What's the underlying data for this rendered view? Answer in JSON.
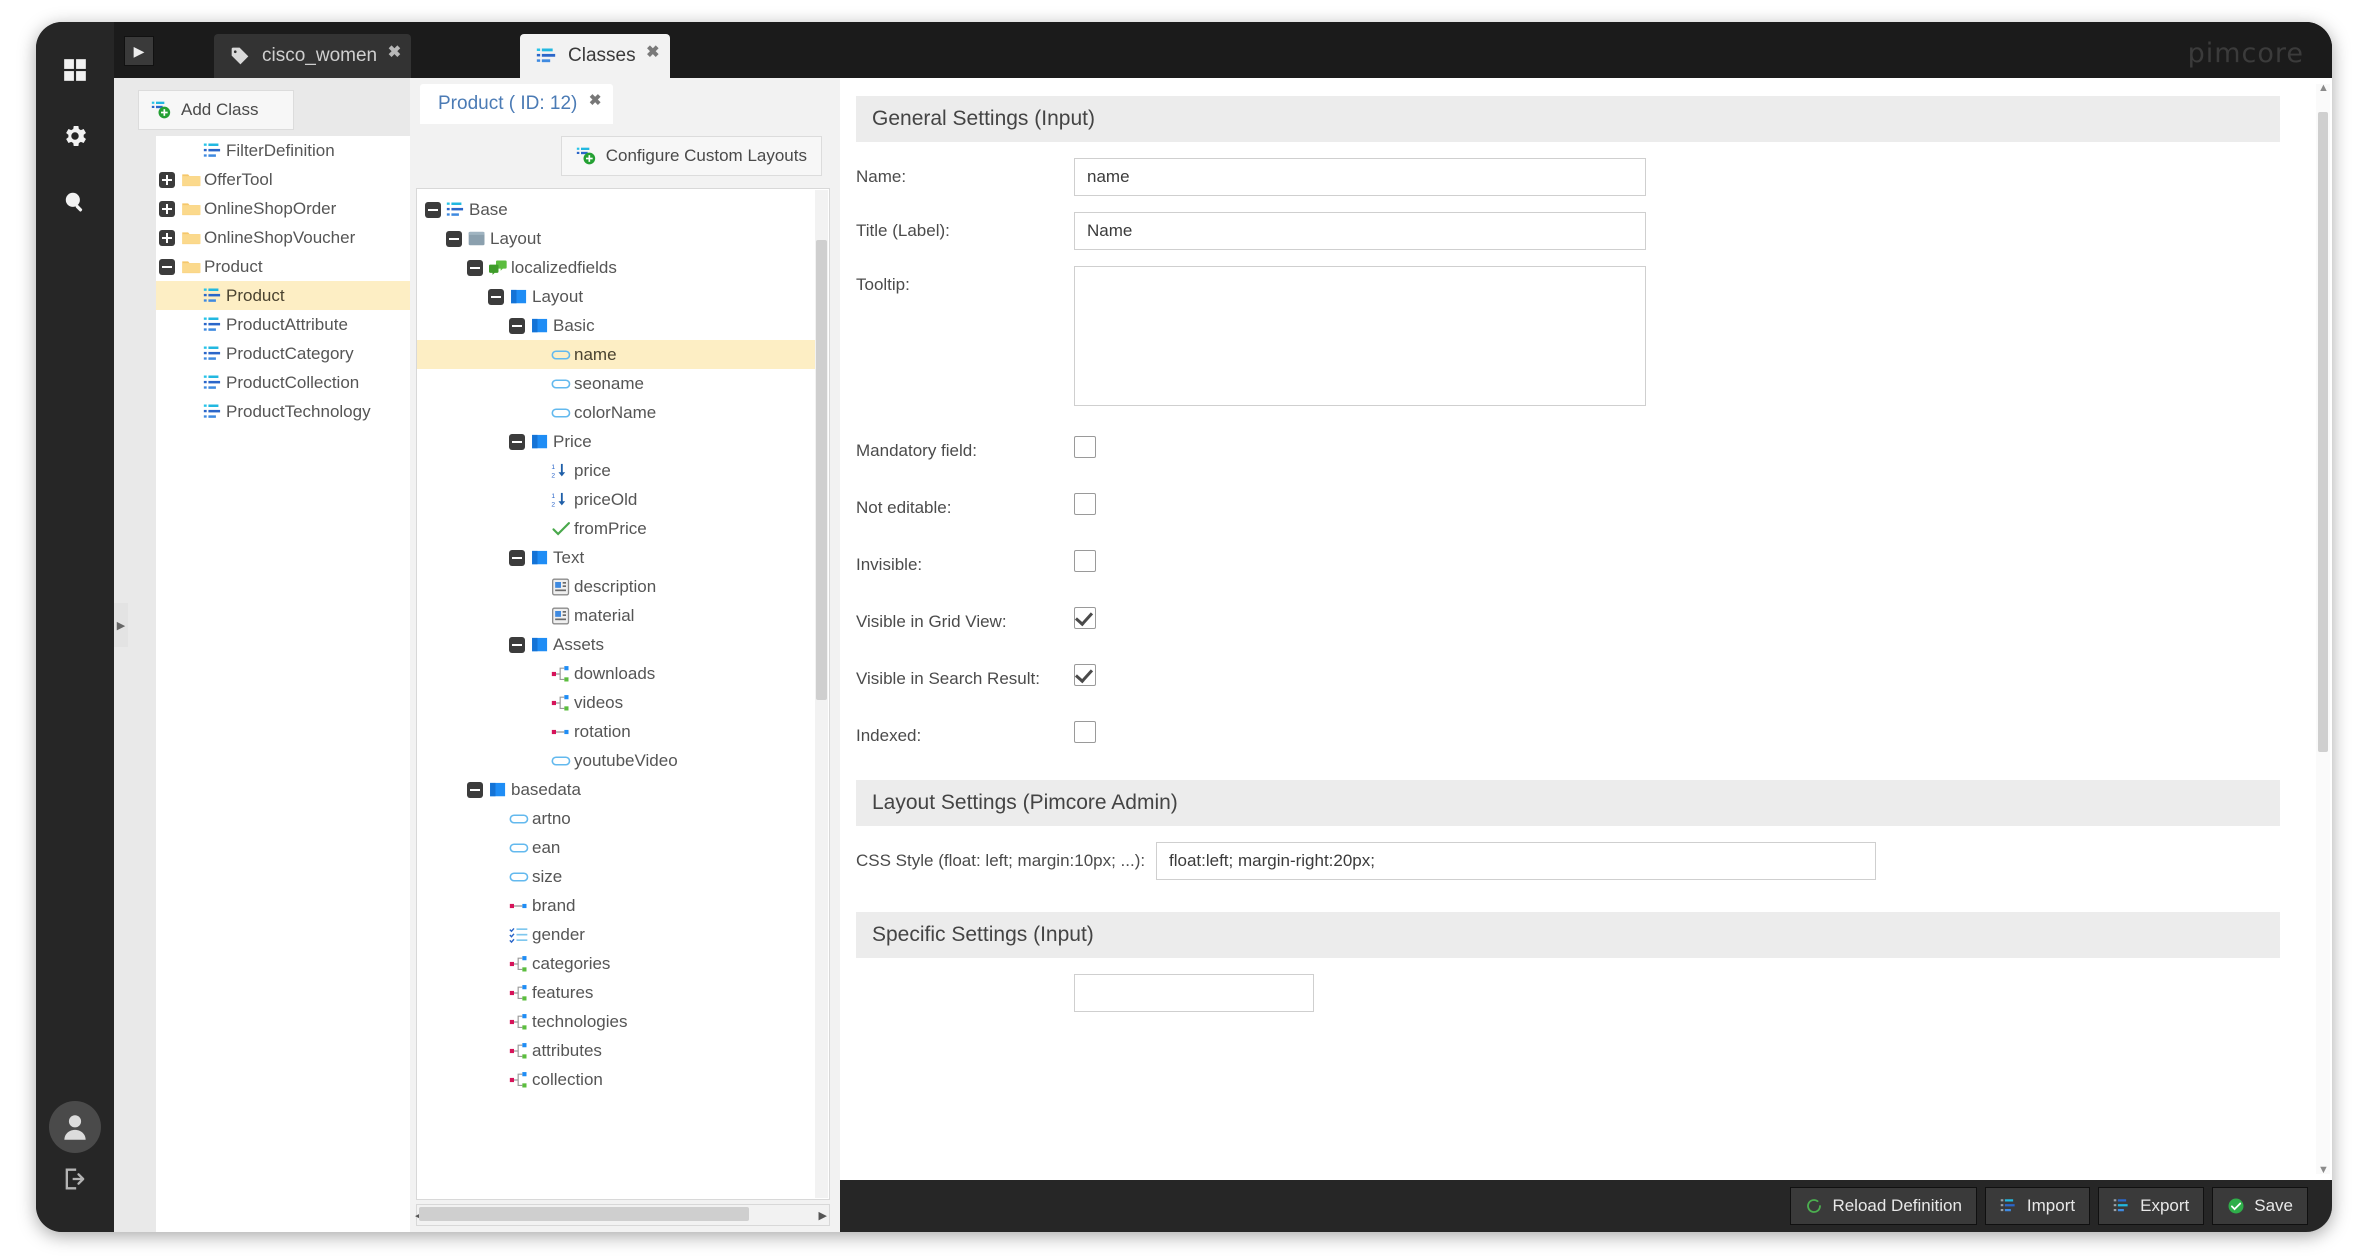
{
  "app": {
    "logo": "pimcore"
  },
  "rail": {
    "icons": [
      {
        "name": "dashboard-icon",
        "glyph": "grid"
      },
      {
        "name": "settings-gear-icon",
        "glyph": "gear"
      },
      {
        "name": "search-icon",
        "glyph": "search"
      }
    ],
    "avatar_label": "user-avatar",
    "logout_label": "logout-icon"
  },
  "topbar": {
    "collapse_label": "▶",
    "tabs": [
      {
        "label": "cisco_women",
        "icon": "tag-icon",
        "active": false,
        "close": "✖"
      },
      {
        "label": "Classes",
        "icon": "class-icon",
        "active": true,
        "close": "✖"
      }
    ]
  },
  "classes_panel": {
    "add_class_label": "Add Class",
    "tree": [
      {
        "label": "FilterDefinition",
        "indent": 1,
        "expander": "none",
        "icon": "class-icon",
        "selected": false
      },
      {
        "label": "OfferTool",
        "indent": 0,
        "expander": "plus",
        "icon": "folder-icon",
        "selected": false
      },
      {
        "label": "OnlineShopOrder",
        "indent": 0,
        "expander": "plus",
        "icon": "folder-icon",
        "selected": false
      },
      {
        "label": "OnlineShopVoucher",
        "indent": 0,
        "expander": "plus",
        "icon": "folder-icon",
        "selected": false
      },
      {
        "label": "Product",
        "indent": 0,
        "expander": "minus",
        "icon": "folder-icon",
        "selected": false
      },
      {
        "label": "Product",
        "indent": 1,
        "expander": "none",
        "icon": "class-icon",
        "selected": true
      },
      {
        "label": "ProductAttribute",
        "indent": 1,
        "expander": "none",
        "icon": "class-icon",
        "selected": false
      },
      {
        "label": "ProductCategory",
        "indent": 1,
        "expander": "none",
        "icon": "class-icon",
        "selected": false
      },
      {
        "label": "ProductCollection",
        "indent": 1,
        "expander": "none",
        "icon": "class-icon",
        "selected": false
      },
      {
        "label": "ProductTechnology",
        "indent": 1,
        "expander": "none",
        "icon": "class-icon",
        "selected": false
      }
    ]
  },
  "field_panel": {
    "doc_tab_label": "Product ( ID: 12)",
    "doc_tab_close": "✖",
    "configure_layouts_label": "Configure Custom Layouts",
    "tree": [
      {
        "label": "Base",
        "indent": 0,
        "expander": "minus",
        "icon": "class-icon",
        "selected": false
      },
      {
        "label": "Layout",
        "indent": 1,
        "expander": "minus",
        "icon": "panel-icon",
        "selected": false
      },
      {
        "label": "localizedfields",
        "indent": 2,
        "expander": "minus",
        "icon": "localized-icon",
        "selected": false
      },
      {
        "label": "Layout",
        "indent": 3,
        "expander": "minus",
        "icon": "tabpanel-icon",
        "selected": false
      },
      {
        "label": "Basic",
        "indent": 4,
        "expander": "minus",
        "icon": "tabpanel-icon",
        "selected": false
      },
      {
        "label": "name",
        "indent": 5,
        "expander": "none",
        "icon": "input-icon",
        "selected": true
      },
      {
        "label": "seoname",
        "indent": 5,
        "expander": "none",
        "icon": "input-icon",
        "selected": false
      },
      {
        "label": "colorName",
        "indent": 5,
        "expander": "none",
        "icon": "input-icon",
        "selected": false
      },
      {
        "label": "Price",
        "indent": 4,
        "expander": "minus",
        "icon": "tabpanel-icon",
        "selected": false
      },
      {
        "label": "price",
        "indent": 5,
        "expander": "none",
        "icon": "numeric-icon",
        "selected": false
      },
      {
        "label": "priceOld",
        "indent": 5,
        "expander": "none",
        "icon": "numeric-icon",
        "selected": false
      },
      {
        "label": "fromPrice",
        "indent": 5,
        "expander": "none",
        "icon": "checkbox-icon",
        "selected": false
      },
      {
        "label": "Text",
        "indent": 4,
        "expander": "minus",
        "icon": "tabpanel-icon",
        "selected": false
      },
      {
        "label": "description",
        "indent": 5,
        "expander": "none",
        "icon": "wysiwyg-icon",
        "selected": false
      },
      {
        "label": "material",
        "indent": 5,
        "expander": "none",
        "icon": "wysiwyg-icon",
        "selected": false
      },
      {
        "label": "Assets",
        "indent": 4,
        "expander": "minus",
        "icon": "tabpanel-icon",
        "selected": false
      },
      {
        "label": "downloads",
        "indent": 5,
        "expander": "none",
        "icon": "relations-icon",
        "selected": false
      },
      {
        "label": "videos",
        "indent": 5,
        "expander": "none",
        "icon": "relations-icon",
        "selected": false
      },
      {
        "label": "rotation",
        "indent": 5,
        "expander": "none",
        "icon": "relation-icon",
        "selected": false
      },
      {
        "label": "youtubeVideo",
        "indent": 5,
        "expander": "none",
        "icon": "input-icon",
        "selected": false
      },
      {
        "label": "basedata",
        "indent": 2,
        "expander": "minus",
        "icon": "tabpanel-icon",
        "selected": false
      },
      {
        "label": "artno",
        "indent": 3,
        "expander": "none",
        "icon": "input-icon",
        "selected": false
      },
      {
        "label": "ean",
        "indent": 3,
        "expander": "none",
        "icon": "input-icon",
        "selected": false
      },
      {
        "label": "size",
        "indent": 3,
        "expander": "none",
        "icon": "input-icon",
        "selected": false
      },
      {
        "label": "brand",
        "indent": 3,
        "expander": "none",
        "icon": "relation-icon",
        "selected": false
      },
      {
        "label": "gender",
        "indent": 3,
        "expander": "none",
        "icon": "multiselect-icon",
        "selected": false
      },
      {
        "label": "categories",
        "indent": 3,
        "expander": "none",
        "icon": "relations-icon",
        "selected": false
      },
      {
        "label": "features",
        "indent": 3,
        "expander": "none",
        "icon": "relations-icon",
        "selected": false
      },
      {
        "label": "technologies",
        "indent": 3,
        "expander": "none",
        "icon": "relations-icon",
        "selected": false
      },
      {
        "label": "attributes",
        "indent": 3,
        "expander": "none",
        "icon": "relations-icon",
        "selected": false
      },
      {
        "label": "collection",
        "indent": 3,
        "expander": "none",
        "icon": "relations-icon",
        "selected": false
      }
    ]
  },
  "settings": {
    "general_section_title": "General Settings (Input)",
    "fields": {
      "name_label": "Name:",
      "name_value": "name",
      "title_label": "Title (Label):",
      "title_value": "Name",
      "tooltip_label": "Tooltip:",
      "tooltip_value": ""
    },
    "checkboxes": [
      {
        "label": "Mandatory field:",
        "checked": false,
        "name": "mandatory-field-checkbox"
      },
      {
        "label": "Not editable:",
        "checked": false,
        "name": "not-editable-checkbox"
      },
      {
        "label": "Invisible:",
        "checked": false,
        "name": "invisible-checkbox"
      },
      {
        "label": "Visible in Grid View:",
        "checked": true,
        "name": "visible-in-grid-view-checkbox"
      },
      {
        "label": "Visible in Search Result:",
        "checked": true,
        "name": "visible-in-search-result-checkbox"
      },
      {
        "label": "Indexed:",
        "checked": false,
        "name": "indexed-checkbox"
      }
    ],
    "layout_section_title": "Layout Settings (Pimcore Admin)",
    "css_style_label": "CSS Style (float: left; margin:10px; ...):",
    "css_style_value": "float:left; margin-right:20px;",
    "specific_section_title": "Specific Settings (Input)"
  },
  "bottom_toolbar": {
    "buttons": [
      {
        "label": "Reload Definition",
        "icon": "reload-icon"
      },
      {
        "label": "Import",
        "icon": "import-icon"
      },
      {
        "label": "Export",
        "icon": "export-icon"
      },
      {
        "label": "Save",
        "icon": "save-check-icon"
      }
    ]
  }
}
